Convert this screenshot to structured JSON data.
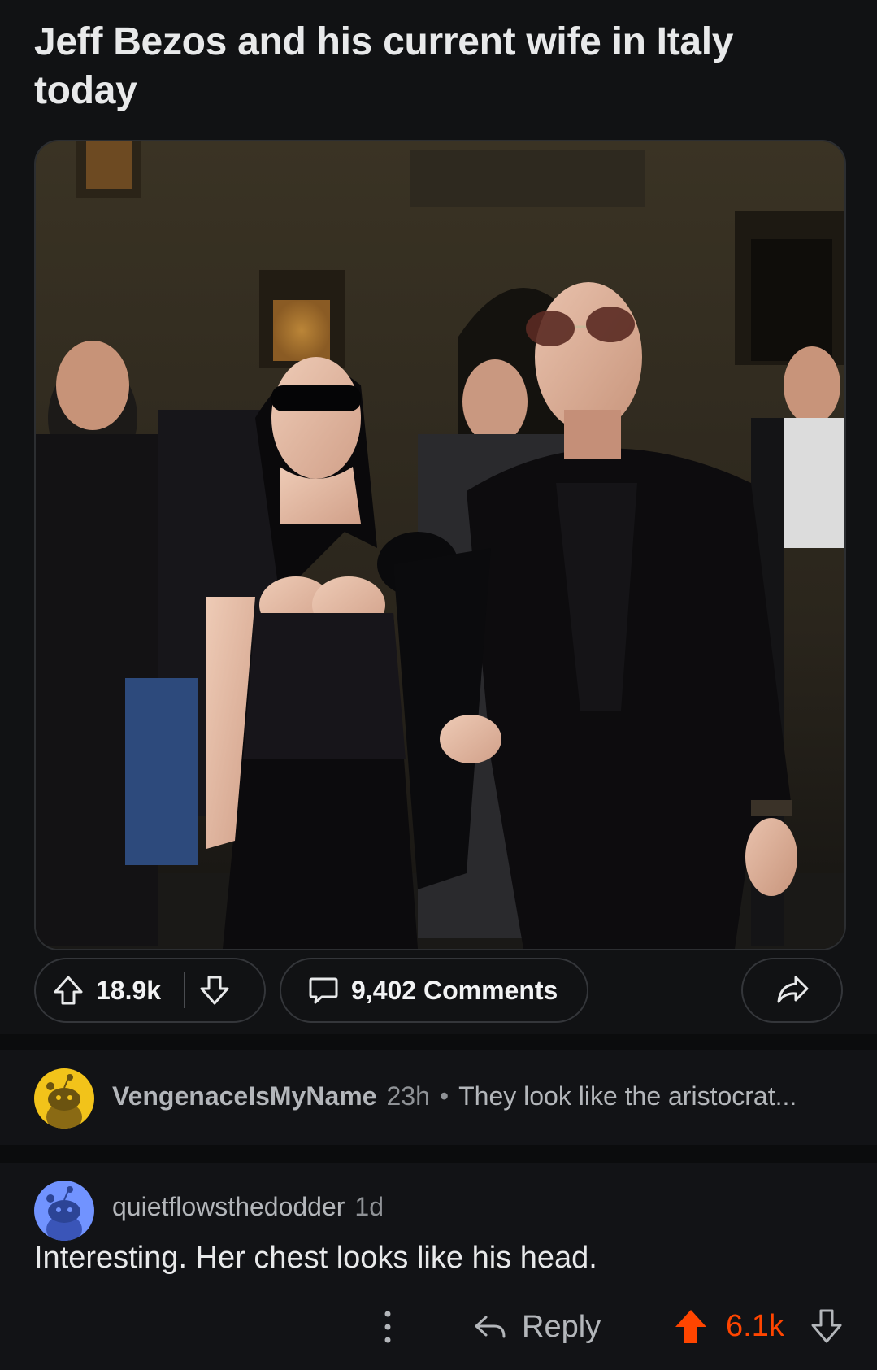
{
  "post": {
    "title": "Jeff Bezos and his current wife in Italy today"
  },
  "actions": {
    "score": "18.9k",
    "comments_label": "9,402 Comments"
  },
  "collapsed_comment": {
    "username": "VengenaceIsMyName",
    "age": "23h",
    "separator": "•",
    "preview": "They look like the aristocrat..."
  },
  "comment": {
    "username": "quietflowsthedodder",
    "age": "1d",
    "body": "Interesting. Her chest looks like his head.",
    "reply_label": "Reply",
    "score": "6.1k"
  },
  "colors": {
    "upvote_active": "#ff4500",
    "background": "#111214",
    "avatar_yellow": "#f2c31a",
    "avatar_blue": "#7193ff"
  },
  "icons": {
    "upvote": "arrow-up-outline-icon",
    "downvote": "arrow-down-outline-icon",
    "comment": "speech-bubble-icon",
    "share": "share-arrow-icon",
    "reply": "reply-arrow-icon",
    "more": "vertical-ellipsis-icon"
  }
}
